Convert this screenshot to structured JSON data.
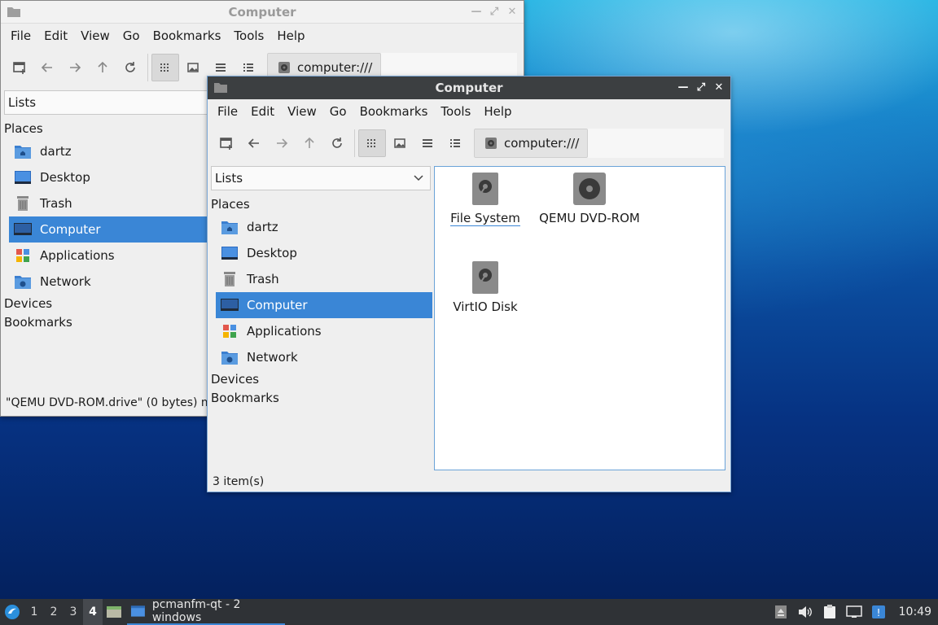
{
  "back_window": {
    "title": "Computer",
    "menu": [
      "File",
      "Edit",
      "View",
      "Go",
      "Bookmarks",
      "Tools",
      "Help"
    ],
    "address": "computer:///",
    "list_select": "Lists",
    "places_label": "Places",
    "places": [
      "dartz",
      "Desktop",
      "Trash",
      "Computer",
      "Applications",
      "Network"
    ],
    "devices_label": "Devices",
    "bookmarks_label": "Bookmarks",
    "status": "\"QEMU DVD-ROM.drive\" (0 bytes) m"
  },
  "front_window": {
    "title": "Computer",
    "menu": [
      "File",
      "Edit",
      "View",
      "Go",
      "Bookmarks",
      "Tools",
      "Help"
    ],
    "address": "computer:///",
    "list_select": "Lists",
    "places_label": "Places",
    "places": [
      "dartz",
      "Desktop",
      "Trash",
      "Computer",
      "Applications",
      "Network"
    ],
    "selected_place": "Computer",
    "devices_label": "Devices",
    "bookmarks_label": "Bookmarks",
    "files": [
      "File System",
      "QEMU DVD-ROM",
      "VirtIO Disk"
    ],
    "status": "3 item(s)"
  },
  "taskbar": {
    "workspaces": [
      "1",
      "2",
      "3",
      "4"
    ],
    "active_workspace": "4",
    "task_label": "pcmanfm-qt - 2 windows",
    "clock": "10:49"
  },
  "colors": {
    "selection": "#3a86d6",
    "titlebar_active": "#3c3f41",
    "taskbar": "#2f3236"
  }
}
